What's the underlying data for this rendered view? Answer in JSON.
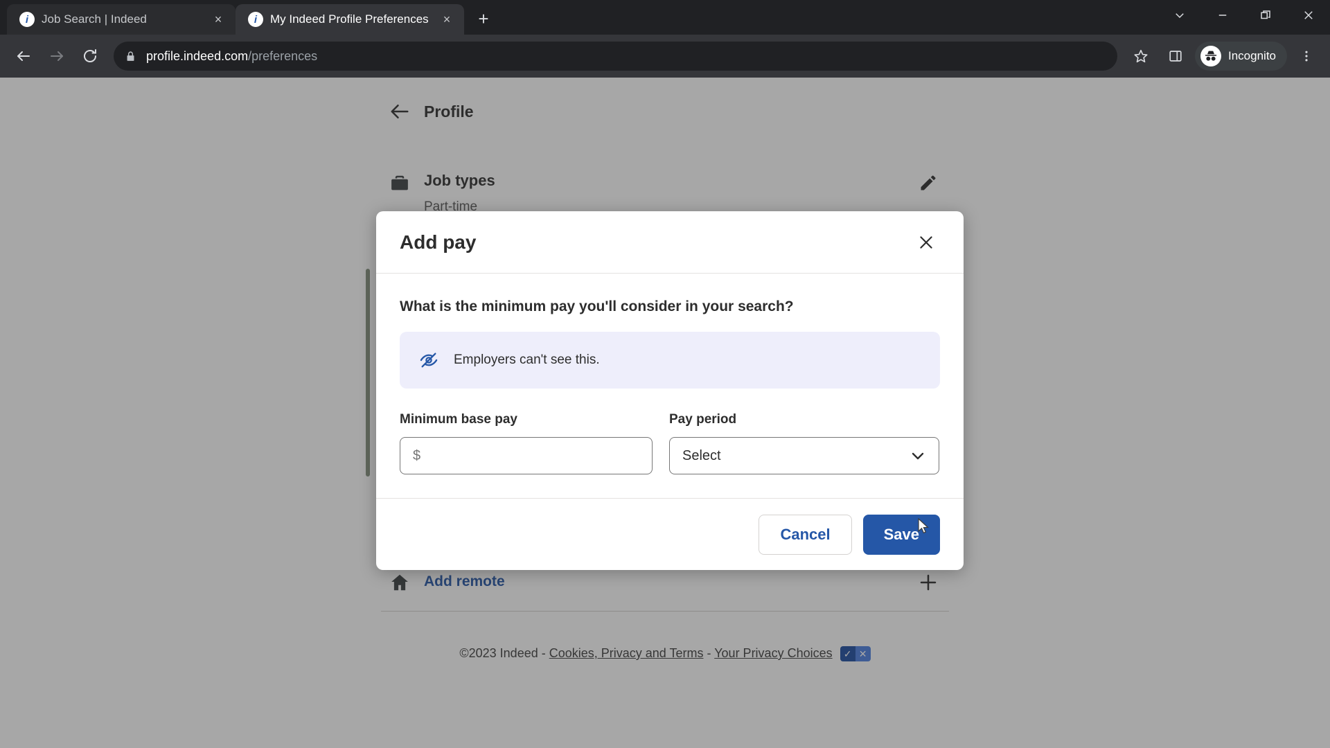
{
  "browser": {
    "tabs": [
      {
        "title": "Job Search | Indeed",
        "favicon": "indeed-favicon",
        "active": false,
        "close_label": "×"
      },
      {
        "title": "My Indeed Profile Preferences",
        "favicon": "indeed-favicon",
        "active": true,
        "close_label": "×"
      }
    ],
    "new_tab_label": "+",
    "window_controls": {
      "tab_search": "tab-search",
      "minimize": "minimize",
      "maximize": "maximize",
      "close": "close"
    },
    "toolbar": {
      "back": "back",
      "forward": "forward",
      "reload": "reload",
      "url_domain": "profile.indeed.com",
      "url_path": "/preferences",
      "bookmark": "bookmark-star",
      "side_panel": "side-panel",
      "profile_label": "Incognito",
      "menu": "chrome-menu"
    }
  },
  "page": {
    "back_label": "Profile",
    "rows": [
      {
        "icon": "briefcase-icon",
        "title": "Job types",
        "subtitle": "Part-time",
        "action": "edit-pencil"
      },
      {
        "icon": "home-icon",
        "link": "Add remote",
        "action": "add-plus"
      }
    ],
    "footer": {
      "copyright": "©2023 Indeed -",
      "link_cookies": "Cookies, Privacy and Terms",
      "separator": "-",
      "link_privacy_choices": "Your Privacy Choices",
      "badge_check": "✓",
      "badge_x": "✕"
    }
  },
  "modal": {
    "title": "Add pay",
    "close_label": "✕",
    "question": "What is the minimum pay you'll consider in your search?",
    "notice": {
      "icon": "eye-slash-icon",
      "text": "Employers can't see this."
    },
    "min_pay": {
      "label": "Minimum base pay",
      "value": "",
      "placeholder": "$"
    },
    "pay_period": {
      "label": "Pay period",
      "selected": "Select",
      "chevron": "chevron-down-icon"
    },
    "buttons": {
      "cancel": "Cancel",
      "save": "Save"
    }
  },
  "colors": {
    "indeed_blue": "#2557a7",
    "notice_bg": "#eeeefb",
    "chrome_dark": "#202124",
    "tab_active": "#35363a"
  }
}
